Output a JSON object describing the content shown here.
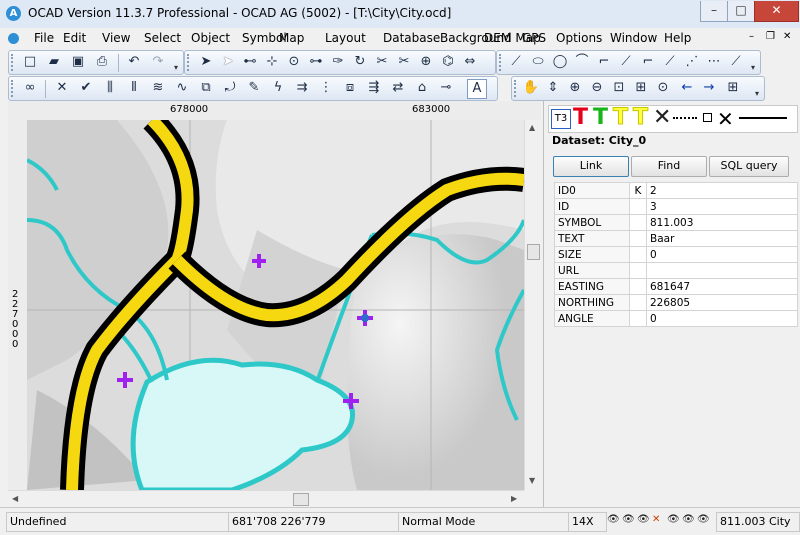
{
  "window": {
    "title": "OCAD Version 11.3.7  Professional - OCAD AG (5002) - [T:\\City\\City.ocd]",
    "app_icon": "A",
    "controls": [
      "–",
      "□",
      "✕"
    ]
  },
  "menu": [
    {
      "label": "File"
    },
    {
      "label": "Edit"
    },
    {
      "label": "View"
    },
    {
      "label": "Select"
    },
    {
      "label": "Object"
    },
    {
      "label": "Symbol"
    },
    {
      "label": "Map"
    },
    {
      "label": "Layout"
    },
    {
      "label": "Database"
    },
    {
      "label": "Background Map"
    },
    {
      "label": "DEM"
    },
    {
      "label": "GPS"
    },
    {
      "label": "Options"
    },
    {
      "label": "Window"
    },
    {
      "label": "Help"
    }
  ],
  "toolbar1": [
    {
      "name": "new-icon",
      "glyph": "🗋"
    },
    {
      "name": "open-icon",
      "glyph": "📂"
    },
    {
      "name": "save-icon",
      "glyph": "💾"
    },
    {
      "name": "print-icon",
      "glyph": "🖶"
    },
    {
      "name": "undo-icon",
      "glyph": "↶"
    },
    {
      "name": "redo-icon",
      "glyph": "↷"
    }
  ],
  "toolbar2": [
    {
      "name": "select-object-icon",
      "glyph": "➤"
    },
    {
      "name": "edit-object-icon",
      "glyph": "⇱"
    },
    {
      "name": "edit-point-icon",
      "glyph": "⊷"
    },
    {
      "name": "add-point-icon",
      "glyph": "⊹"
    },
    {
      "name": "remove-point-icon",
      "glyph": "⊙"
    },
    {
      "name": "move-point-icon",
      "glyph": "⊶"
    },
    {
      "name": "cut-object-icon",
      "glyph": "✑"
    },
    {
      "name": "rotate-icon",
      "glyph": "↻"
    },
    {
      "name": "cut-hole-icon",
      "glyph": "✂"
    },
    {
      "name": "merge-icon",
      "glyph": "✂"
    },
    {
      "name": "reshape-icon",
      "glyph": "⊕"
    },
    {
      "name": "straighten-icon",
      "glyph": "⌬"
    },
    {
      "name": "stretch-icon",
      "glyph": "⇔"
    }
  ],
  "toolbar3": [
    {
      "name": "curve-mode-icon",
      "glyph": "⟋"
    },
    {
      "name": "ellipse-mode-icon",
      "glyph": "⬭"
    },
    {
      "name": "circle-mode-icon",
      "glyph": "◯"
    },
    {
      "name": "rectangle-mode-icon",
      "glyph": "⌒"
    },
    {
      "name": "straight-line-icon",
      "glyph": "⌐"
    },
    {
      "name": "freehand-icon",
      "glyph": "⟋"
    },
    {
      "name": "numeric-mode-icon",
      "glyph": "⋰"
    },
    {
      "name": "fill-mode-icon",
      "glyph": "⋯"
    }
  ],
  "toolbar4": [
    {
      "name": "binoculars-icon",
      "glyph": "👀"
    },
    {
      "name": "delete-icon",
      "glyph": "✕"
    },
    {
      "name": "check-icon",
      "glyph": "✔"
    },
    {
      "name": "parallel-lines-icon",
      "glyph": "⫼"
    },
    {
      "name": "comb-icon",
      "glyph": "⩸"
    },
    {
      "name": "ladder-icon",
      "glyph": "≋"
    },
    {
      "name": "smooth-icon",
      "glyph": "∿"
    },
    {
      "name": "join-icon",
      "glyph": "⧉"
    },
    {
      "name": "reverse-icon",
      "glyph": "⤾"
    },
    {
      "name": "graphics-icon",
      "glyph": "✎"
    },
    {
      "name": "lightning-icon",
      "glyph": "ϟ"
    },
    {
      "name": "move-parallel-icon",
      "glyph": "⇉"
    },
    {
      "name": "fill-icon",
      "glyph": "⋮"
    },
    {
      "name": "duplicate-icon",
      "glyph": "⧈"
    },
    {
      "name": "arrange-icon",
      "glyph": "⇶"
    },
    {
      "name": "convert-icon",
      "glyph": "⇄"
    },
    {
      "name": "text-tool-icon",
      "glyph": "A"
    }
  ],
  "toolbar5": [
    {
      "name": "hand-tool-icon",
      "glyph": "✋"
    },
    {
      "name": "scroll-map-icon",
      "glyph": "⇕"
    },
    {
      "name": "zoom-in-icon",
      "glyph": "⊕"
    },
    {
      "name": "zoom-out-icon",
      "glyph": "⊖"
    },
    {
      "name": "zoom-window-icon",
      "glyph": "⊡"
    },
    {
      "name": "entire-map-icon",
      "glyph": "⊞"
    },
    {
      "name": "previous-view-icon",
      "glyph": "←"
    },
    {
      "name": "next-view-icon",
      "glyph": "→"
    },
    {
      "name": "grid-icon",
      "glyph": "⊞"
    }
  ],
  "ruler": {
    "x_labels": [
      "678000",
      "683000"
    ],
    "y_label": "227000"
  },
  "database": {
    "dataset_title": "Dataset: City_0",
    "buttons": [
      "Link",
      "Find",
      "SQL query"
    ],
    "rows": [
      {
        "name": "ID0",
        "key": "K",
        "value": "2"
      },
      {
        "name": "ID",
        "key": "",
        "value": "3"
      },
      {
        "name": "SYMBOL",
        "key": "",
        "value": "811.003"
      },
      {
        "name": "TEXT",
        "key": "",
        "value": "Baar"
      },
      {
        "name": "SIZE",
        "key": "",
        "value": "0"
      },
      {
        "name": "URL",
        "key": "",
        "value": ""
      },
      {
        "name": "EASTING",
        "key": "",
        "value": "681647"
      },
      {
        "name": "NORTHING",
        "key": "",
        "value": "226805"
      },
      {
        "name": "ANGLE",
        "key": "",
        "value": "0"
      }
    ],
    "symbol_strip": {
      "text_symbol_label": "T3"
    }
  },
  "status": {
    "state": "Undefined",
    "coordinates": "681'708   226'779",
    "mode": "Normal Mode",
    "zoom": "14X",
    "symbol": "811.003 City"
  },
  "colors": {
    "road_fill": "#f5d80f",
    "road_outline": "#000000",
    "water_line": "#2ec8c8",
    "water_fill": "#d8f8f8",
    "symbol_marker": "#a020f0"
  }
}
